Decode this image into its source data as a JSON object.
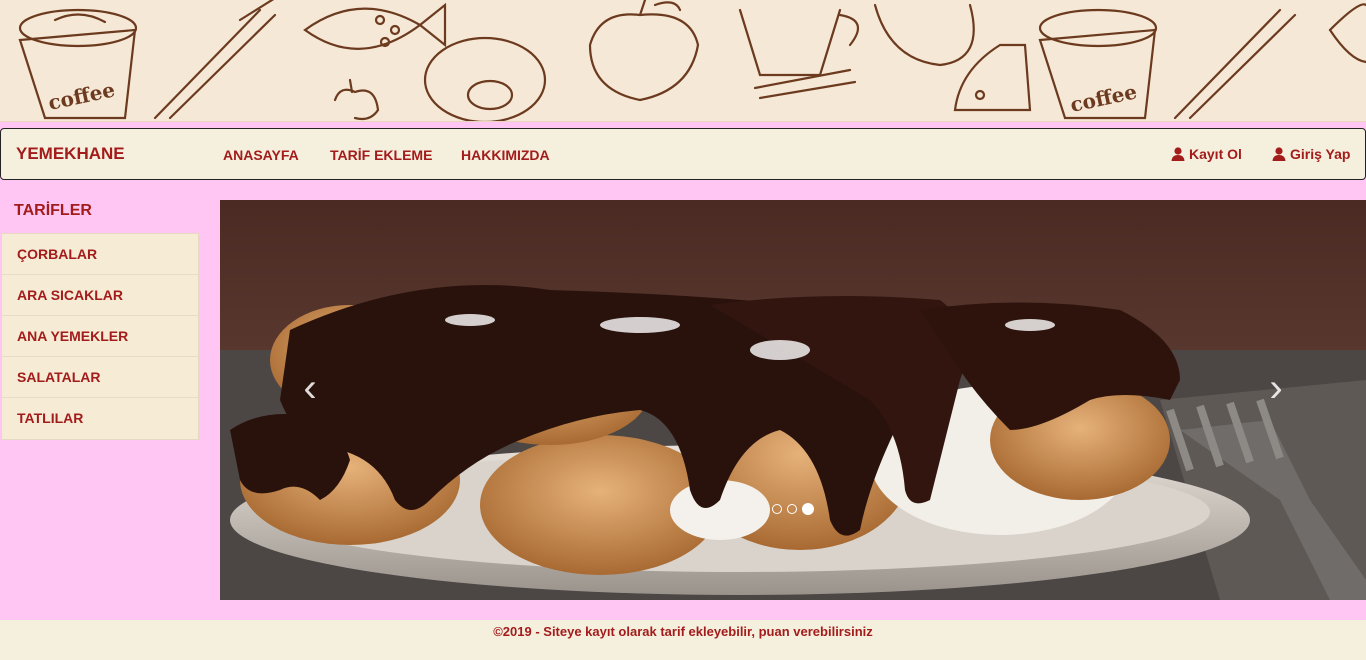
{
  "navbar": {
    "brand": "YEMEKHANE",
    "links": [
      "ANASAYFA",
      "TARİF EKLEME",
      "HAKKIMIZDA"
    ],
    "register": "Kayıt Ol",
    "login": "Giriş Yap"
  },
  "banner": {
    "coffee_text_1": "coffee",
    "coffee_text_2": "coffee"
  },
  "sidebar": {
    "title": "TARİFLER",
    "items": [
      "ÇORBALAR",
      "ARA SICAKLAR",
      "ANA YEMEKLER",
      "SALATALAR",
      "TATLILAR"
    ]
  },
  "carousel": {
    "prev_icon": "chevron-left-icon",
    "next_icon": "chevron-right-icon",
    "slide_count": 3,
    "active_slide": 3
  },
  "footer": {
    "text": "©2019 - Siteye kayıt olarak tarif ekleyebilir, puan verebilirsiniz"
  },
  "colors": {
    "page_bg": "#ffc6f3",
    "panel_bg": "#f5efdd",
    "accent": "#a31c1c"
  }
}
